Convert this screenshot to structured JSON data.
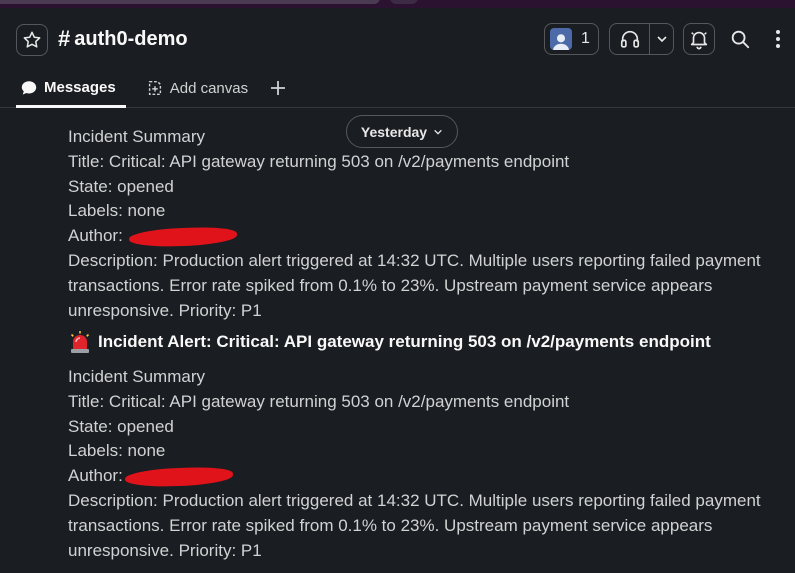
{
  "header": {
    "channel_name": "auth0-demo",
    "members_count": "1"
  },
  "tabs": [
    {
      "label": "Messages"
    },
    {
      "label": "Add canvas"
    }
  ],
  "date_divider": "Yesterday",
  "messages": [
    {
      "summary": "Incident Summary",
      "title": "Title: Critical: API gateway returning 503 on /v2/payments endpoint",
      "state": "State: opened",
      "labels": "Labels: none",
      "author_label": "Author:",
      "description": "Description: Production alert triggered at 14:32 UTC. Multiple users reporting failed payment transactions. Error rate spiked from 0.1% to 23%. Upstream payment service appears unresponsive. Priority: P1"
    },
    {
      "alert_title": "Incident Alert: Critical: API gateway returning 503 on /v2/payments endpoint",
      "summary": "Incident Summary",
      "title": "Title: Critical: API gateway returning 503 on /v2/payments endpoint",
      "state": "State: opened",
      "labels": "Labels: none",
      "author_label": "Author:",
      "description": "Description: Production alert triggered at 14:32 UTC. Multiple users reporting failed payment transactions. Error rate spiked from 0.1% to 23%. Upstream payment service appears unresponsive. Priority: P1"
    }
  ],
  "icons": {
    "star": "star-icon",
    "members": "avatar-icon",
    "huddle": "headphones-icon",
    "notifications": "bell-icon",
    "search": "search-icon",
    "more": "more-vertical-icon",
    "messages_tab": "message-bubble-icon",
    "canvas_tab": "canvas-icon",
    "alert": "siren-icon"
  },
  "colors": {
    "background": "#1a1d21",
    "text": "#d1d2d3",
    "redaction": "#e0131b",
    "titlebar": "#2b1230"
  }
}
